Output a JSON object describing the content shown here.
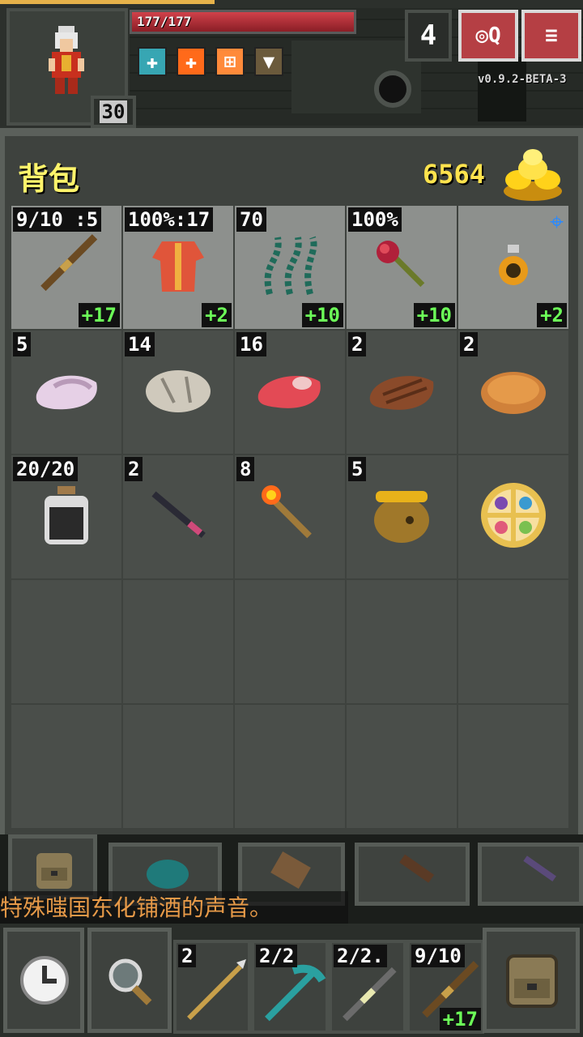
{
  "hud": {
    "hp_text": "177/177",
    "level": "30",
    "depth": "4",
    "journal_icon": "journal-icon",
    "menu_icon": "menu-icon",
    "version": "v0.9.2-BETA-3",
    "buffs": [
      {
        "name": "cross-buff-icon",
        "color": "#37a6b3"
      },
      {
        "name": "health-buff-icon",
        "color": "#ff6a1a"
      },
      {
        "name": "regen-buff-icon",
        "color": "#ff8a3a"
      },
      {
        "name": "shield-buff-icon",
        "color": "#6b5a3c"
      }
    ]
  },
  "inventory": {
    "title": "背包",
    "gold": "6564",
    "slots": [
      {
        "qty": "9/10 :5",
        "lvl": "+17",
        "icon": "staff-icon",
        "equipped": true
      },
      {
        "qty": "100%:17",
        "lvl": "+2",
        "icon": "robe-armor-icon",
        "equipped": true
      },
      {
        "qty": "70",
        "lvl": "+10",
        "icon": "chain-artifact-icon",
        "equipped": true
      },
      {
        "qty": "100%",
        "lvl": "+10",
        "icon": "rose-artifact-icon",
        "equipped": true
      },
      {
        "qty": "",
        "lvl": "+2",
        "icon": "ring-icon",
        "equipped": true
      },
      {
        "qty": "5",
        "lvl": "",
        "icon": "mystery-meat-icon"
      },
      {
        "qty": "14",
        "lvl": "",
        "icon": "stone-icon"
      },
      {
        "qty": "16",
        "lvl": "",
        "icon": "raw-meat-icon"
      },
      {
        "qty": "2",
        "lvl": "",
        "icon": "cooked-steak-icon"
      },
      {
        "qty": "2",
        "lvl": "",
        "icon": "pasty-icon"
      },
      {
        "qty": "20/20",
        "lvl": "",
        "icon": "dew-vial-icon"
      },
      {
        "qty": "2",
        "lvl": "",
        "icon": "dart-icon"
      },
      {
        "qty": "8",
        "lvl": "",
        "icon": "torch-icon"
      },
      {
        "qty": "5",
        "lvl": "",
        "icon": "honey-pot-icon"
      },
      {
        "qty": "",
        "lvl": "",
        "icon": "pie-icon"
      },
      {
        "qty": "",
        "lvl": "",
        "icon": ""
      },
      {
        "qty": "",
        "lvl": "",
        "icon": ""
      },
      {
        "qty": "",
        "lvl": "",
        "icon": ""
      },
      {
        "qty": "",
        "lvl": "",
        "icon": ""
      },
      {
        "qty": "",
        "lvl": "",
        "icon": ""
      },
      {
        "qty": "",
        "lvl": "",
        "icon": ""
      },
      {
        "qty": "",
        "lvl": "",
        "icon": ""
      },
      {
        "qty": "",
        "lvl": "",
        "icon": ""
      },
      {
        "qty": "",
        "lvl": "",
        "icon": ""
      },
      {
        "qty": "",
        "lvl": "",
        "icon": ""
      }
    ],
    "tabs": [
      {
        "icon": "backpack-tab-icon"
      },
      {
        "icon": "seed-pouch-tab-icon"
      },
      {
        "icon": "scroll-holder-tab-icon"
      },
      {
        "icon": "wand-holster-tab-icon"
      },
      {
        "icon": "potion-bandolier-tab-icon"
      }
    ]
  },
  "log": {
    "message": "特殊嗤国东化铺酒的声音。"
  },
  "toolbar": {
    "wait_icon": "clock-icon",
    "search_icon": "magnifier-icon",
    "backpack_icon": "backpack-icon",
    "quickslots": [
      {
        "qty": "2",
        "lvl": "",
        "icon": "spear-icon"
      },
      {
        "qty": "2/2",
        "lvl": "",
        "icon": "pickaxe-icon"
      },
      {
        "qty": "2/2.",
        "lvl": "",
        "icon": "wand-icon"
      },
      {
        "qty": "9/10",
        "lvl": "+17",
        "icon": "staff-quick-icon"
      }
    ]
  }
}
